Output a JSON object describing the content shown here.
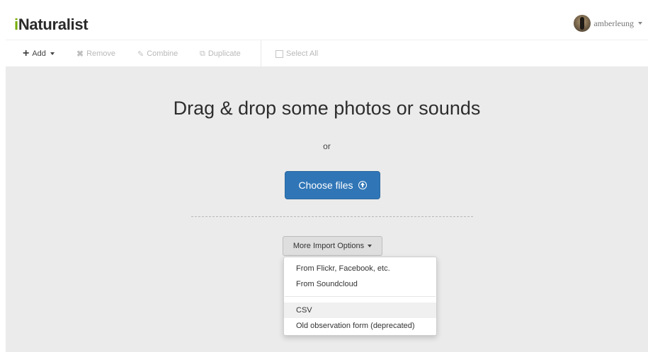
{
  "header": {
    "logo_first": "i",
    "logo_rest": "Naturalist",
    "username": "amberleung"
  },
  "toolbar": {
    "add_label": "Add",
    "remove_label": "Remove",
    "combine_label": "Combine",
    "duplicate_label": "Duplicate",
    "select_all_label": "Select All"
  },
  "main": {
    "drop_title": "Drag & drop some photos or sounds",
    "or_text": "or",
    "choose_files_label": "Choose files",
    "more_options_label": "More Import Options"
  },
  "import_menu": {
    "items": [
      {
        "label": "From Flickr, Facebook, etc."
      },
      {
        "label": "From Soundcloud"
      },
      {
        "label": "CSV"
      },
      {
        "label": "Old observation form (deprecated)"
      }
    ]
  },
  "colors": {
    "brand_green": "#74ac00",
    "primary_button": "#3076b7",
    "dropzone_bg": "#ebebeb"
  },
  "icons": {
    "add": "plus-icon",
    "remove": "x-icon",
    "combine": "pencil-icon",
    "duplicate": "copy-icon",
    "select_all": "checkbox-icon",
    "choose_files": "upload-circle-icon"
  }
}
